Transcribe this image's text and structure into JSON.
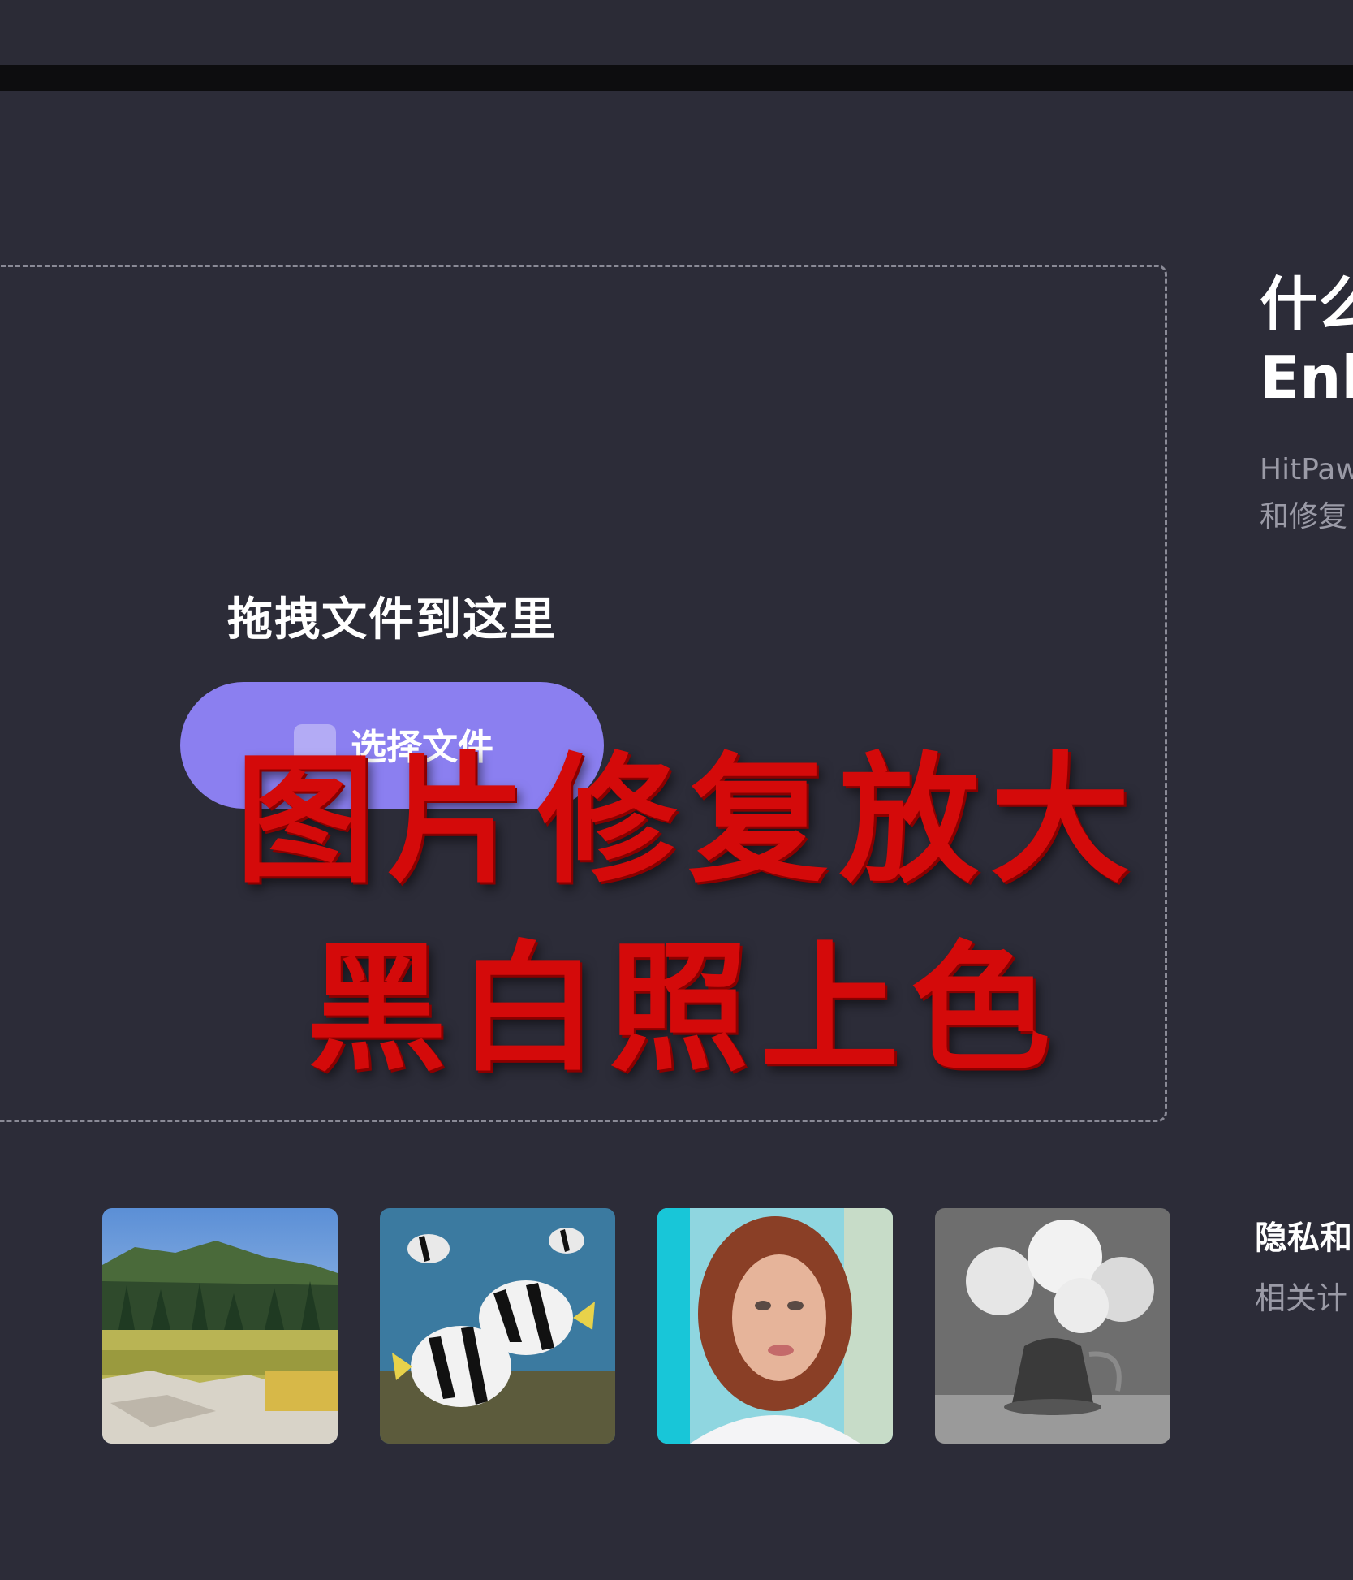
{
  "dropzone": {
    "title": "拖拽文件到这里",
    "button_label": "选择文件"
  },
  "overlay": {
    "line1": "图片修复放大",
    "line2": "黑白照上色"
  },
  "info": {
    "heading_line1": "什么",
    "heading_line2": "Enh",
    "desc_line1": "HitPaw",
    "desc_line2": "和修复"
  },
  "privacy": {
    "title": "隐私和",
    "desc": "相关计"
  },
  "samples": [
    {
      "icon": "landscape-thumbnail"
    },
    {
      "icon": "fish-thumbnail"
    },
    {
      "icon": "portrait-thumbnail"
    },
    {
      "icon": "flower-vase-thumbnail"
    }
  ],
  "colors": {
    "background": "#2c2c38",
    "accent_button": "#8b7ff0",
    "overlay_red": "#d40a0a"
  }
}
